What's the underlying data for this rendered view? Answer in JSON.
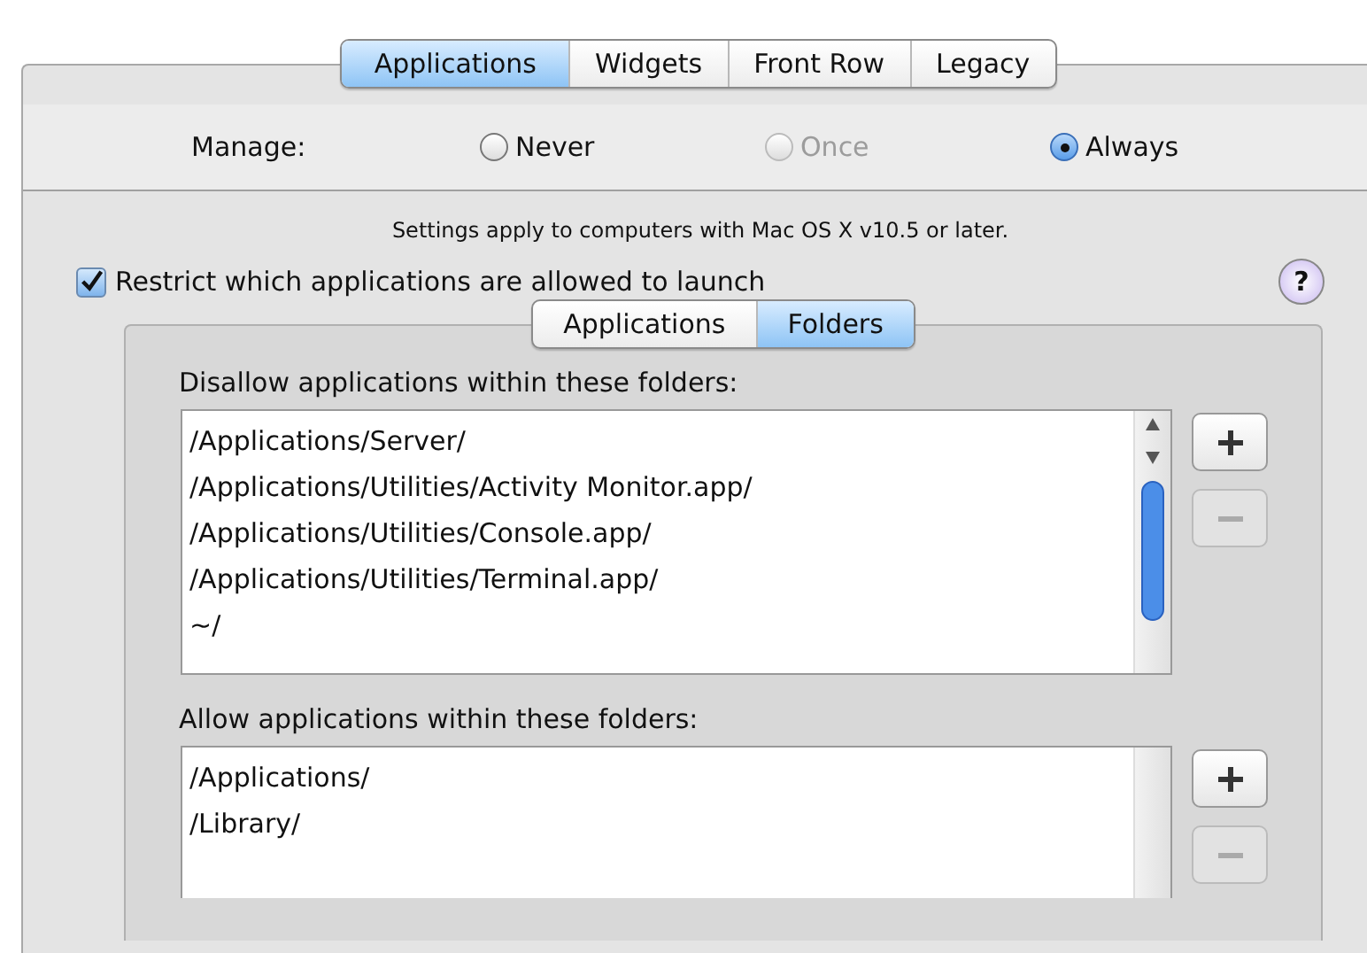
{
  "top_tabs": [
    {
      "label": "Applications",
      "selected": true
    },
    {
      "label": "Widgets",
      "selected": false
    },
    {
      "label": "Front Row",
      "selected": false
    },
    {
      "label": "Legacy",
      "selected": false
    }
  ],
  "manage": {
    "label": "Manage:",
    "options": [
      {
        "label": "Never",
        "selected": false,
        "disabled": false
      },
      {
        "label": "Once",
        "selected": false,
        "disabled": true
      },
      {
        "label": "Always",
        "selected": true,
        "disabled": false
      }
    ]
  },
  "note": "Settings apply to computers with Mac OS X v10.5 or later.",
  "restrict": {
    "label": "Restrict which applications are allowed to launch",
    "checked": true
  },
  "help": {
    "label": "?"
  },
  "sub_tabs": [
    {
      "label": "Applications",
      "selected": false
    },
    {
      "label": "Folders",
      "selected": true
    }
  ],
  "lists": [
    {
      "title": "Disallow applications within these folders:",
      "items": [
        "/Applications/Server/",
        "/Applications/Utilities/Activity Monitor.app/",
        "/Applications/Utilities/Console.app/",
        "/Applications/Utilities/Terminal.app/",
        "~/"
      ],
      "buttons": [
        {
          "kind": "add",
          "disabled": false
        },
        {
          "kind": "remove",
          "disabled": true
        }
      ]
    },
    {
      "title": "Allow applications within these folders:",
      "items": [
        "/Applications/",
        "/Library/"
      ],
      "buttons": [
        {
          "kind": "add",
          "disabled": false
        },
        {
          "kind": "remove",
          "disabled": true
        }
      ]
    }
  ]
}
